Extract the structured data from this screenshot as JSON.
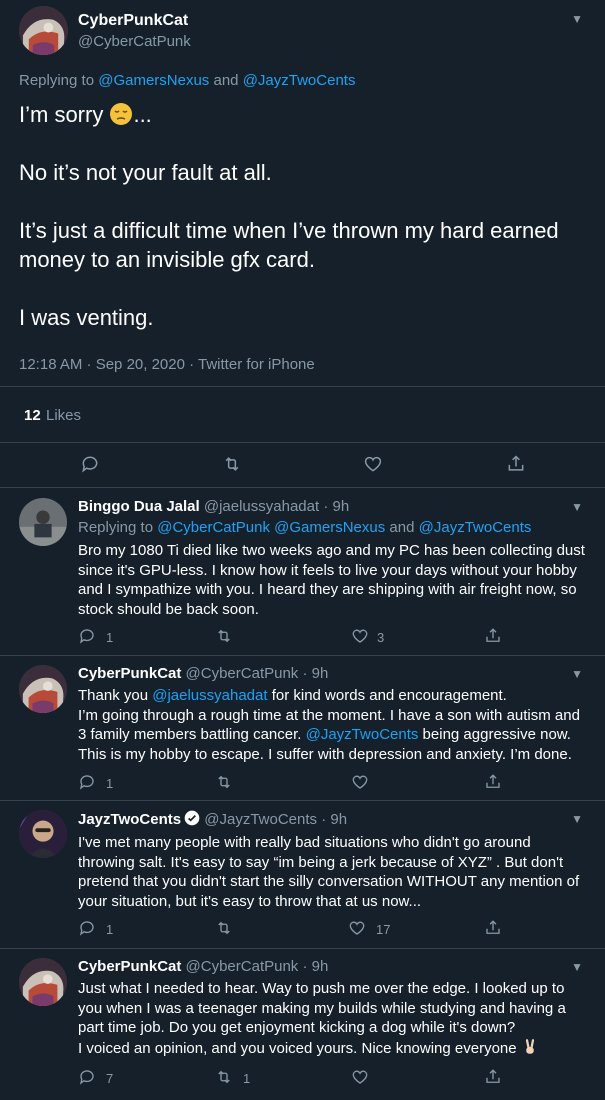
{
  "main_tweet": {
    "name": "CyberPunkCat",
    "handle": "@CyberCatPunk",
    "replying_prefix": "Replying to",
    "replying_to_1": "@GamersNexus",
    "replying_and": "and",
    "replying_to_2": "@JayzTwoCents",
    "line1": "I’m sorry",
    "line1_suffix": "...",
    "line2": "No it’s not your fault at all.",
    "line3": "It’s just a difficult time when I’ve thrown my hard earned money to an invisible gfx card.",
    "line4": "I was venting.",
    "meta": "12:18 AM · Sep 20, 2020 · Twitter for iPhone",
    "likes_count": "12",
    "likes_label": "Likes"
  },
  "replies": [
    {
      "name": "Binggo Dua Jalal",
      "handle": "@jaelussyahadat",
      "time": "· 9h",
      "replying_prefix": "Replying to",
      "replying_to": "@CyberCatPunk @GamersNexus",
      "replying_and": "and",
      "replying_to_2": "@JayzTwoCents",
      "text": "Bro my 1080 Ti died like two weeks ago and my PC has been collecting dust since it's GPU-less. I know how it feels to live your days without your hobby and I sympathize with you. I heard they are shipping with air freight now, so stock should be back soon.",
      "replies_count": "1",
      "retweets_count": "",
      "likes_count": "3"
    },
    {
      "name": "CyberPunkCat",
      "handle": "@CyberCatPunk",
      "time": "· 9h",
      "text_a": "Thank you",
      "mention_a": "@jaelussyahadat",
      "text_b": "for kind words and encouragement.",
      "text_c": "I’m going through a rough time at the moment. I have a son with autism and 3 family members battling cancer.",
      "mention_b": "@JayzTwoCents",
      "text_d": "being aggressive now.",
      "text_e": "This is my hobby to escape. I suffer with depression and anxiety. I’m done.",
      "replies_count": "1",
      "retweets_count": "",
      "likes_count": ""
    },
    {
      "name": "JayzTwoCents",
      "handle": "@JayzTwoCents",
      "time": "· 9h",
      "text": "I've met many people with really bad situations who didn't go around throwing salt. It's easy to say “im being a jerk because of XYZ” . But don't pretend that you didn't start the silly conversation WITHOUT any mention of your situation, but it's easy to throw that at us now...",
      "replies_count": "1",
      "retweets_count": "",
      "likes_count": "17"
    },
    {
      "name": "CyberPunkCat",
      "handle": "@CyberCatPunk",
      "time": "· 9h",
      "text": "Just what I needed to hear. Way to push me over the edge. I looked up to you when I was a teenager making my builds while studying and having a part time job. Do you get enjoyment kicking a dog while it's down?",
      "text_2": "I voiced an opinion, and you voiced yours. Nice knowing everyone",
      "replies_count": "7",
      "retweets_count": "1",
      "likes_count": ""
    }
  ],
  "icons": {
    "reply": "reply-icon",
    "retweet": "retweet-icon",
    "like": "heart-icon",
    "share": "share-icon",
    "more": "chevron-down-icon",
    "verified": "verified-badge-icon"
  },
  "colors": {
    "background": "#15202b",
    "link": "#1da1f2",
    "muted": "#8899a6",
    "divider": "#38444d"
  }
}
